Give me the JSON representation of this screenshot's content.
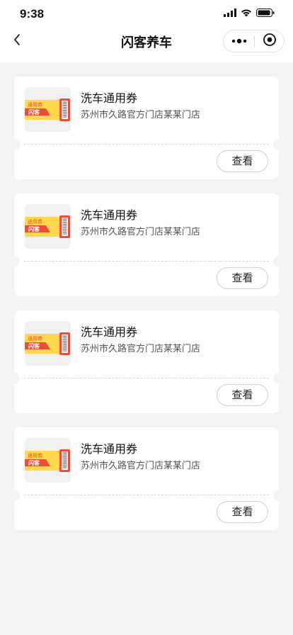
{
  "status_bar": {
    "time": "9:38"
  },
  "navbar": {
    "title": "闪客养车"
  },
  "coupons": [
    {
      "title": "洗车通用券",
      "store": "苏州市久路官方门店某某门店",
      "action_label": "查看",
      "ticket_tag": "通用券",
      "ticket_brand": "闪客"
    },
    {
      "title": "洗车通用券",
      "store": "苏州市久路官方门店某某门店",
      "action_label": "查看",
      "ticket_tag": "通用券",
      "ticket_brand": "闪客"
    },
    {
      "title": "洗车通用券",
      "store": "苏州市久路官方门店某某门店",
      "action_label": "查看",
      "ticket_tag": "通用券",
      "ticket_brand": "闪客"
    },
    {
      "title": "洗车通用券",
      "store": "苏州市久路官方门店某某门店",
      "action_label": "查看",
      "ticket_tag": "通用券",
      "ticket_brand": "闪客"
    }
  ],
  "icons": {
    "back": "chevron-left-icon",
    "more": "more-dots-icon",
    "close": "target-circle-icon",
    "signal": "signal-icon",
    "wifi": "wifi-icon",
    "battery": "battery-icon",
    "ticket": "ticket-icon"
  },
  "colors": {
    "background": "#f4f4f4",
    "card": "#ffffff",
    "ticket_yellow": "#ffd84d",
    "ticket_red": "#ef4b38"
  }
}
